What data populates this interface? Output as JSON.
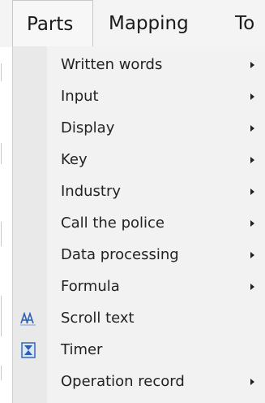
{
  "menubar": {
    "items": [
      {
        "label": "Parts"
      },
      {
        "label": "Mapping"
      },
      {
        "label": "To"
      }
    ]
  },
  "dropdown": {
    "items": [
      {
        "label": "Written words",
        "submenu": true
      },
      {
        "label": "Input",
        "submenu": true
      },
      {
        "label": "Display",
        "submenu": true
      },
      {
        "label": "Key",
        "submenu": true
      },
      {
        "label": "Industry",
        "submenu": true
      },
      {
        "label": "Call the police",
        "submenu": true
      },
      {
        "label": "Data processing",
        "submenu": true
      },
      {
        "label": "Formula",
        "submenu": true
      },
      {
        "label": "Scroll text",
        "submenu": false,
        "icon": "scroll-text-icon"
      },
      {
        "label": "Timer",
        "submenu": false,
        "icon": "hourglass-icon"
      },
      {
        "label": "Operation record",
        "submenu": true
      }
    ]
  },
  "colors": {
    "icon_blue": "#2a5fb5",
    "menu_background": "#f2f2f2",
    "gutter_background": "#e9e9e9"
  }
}
